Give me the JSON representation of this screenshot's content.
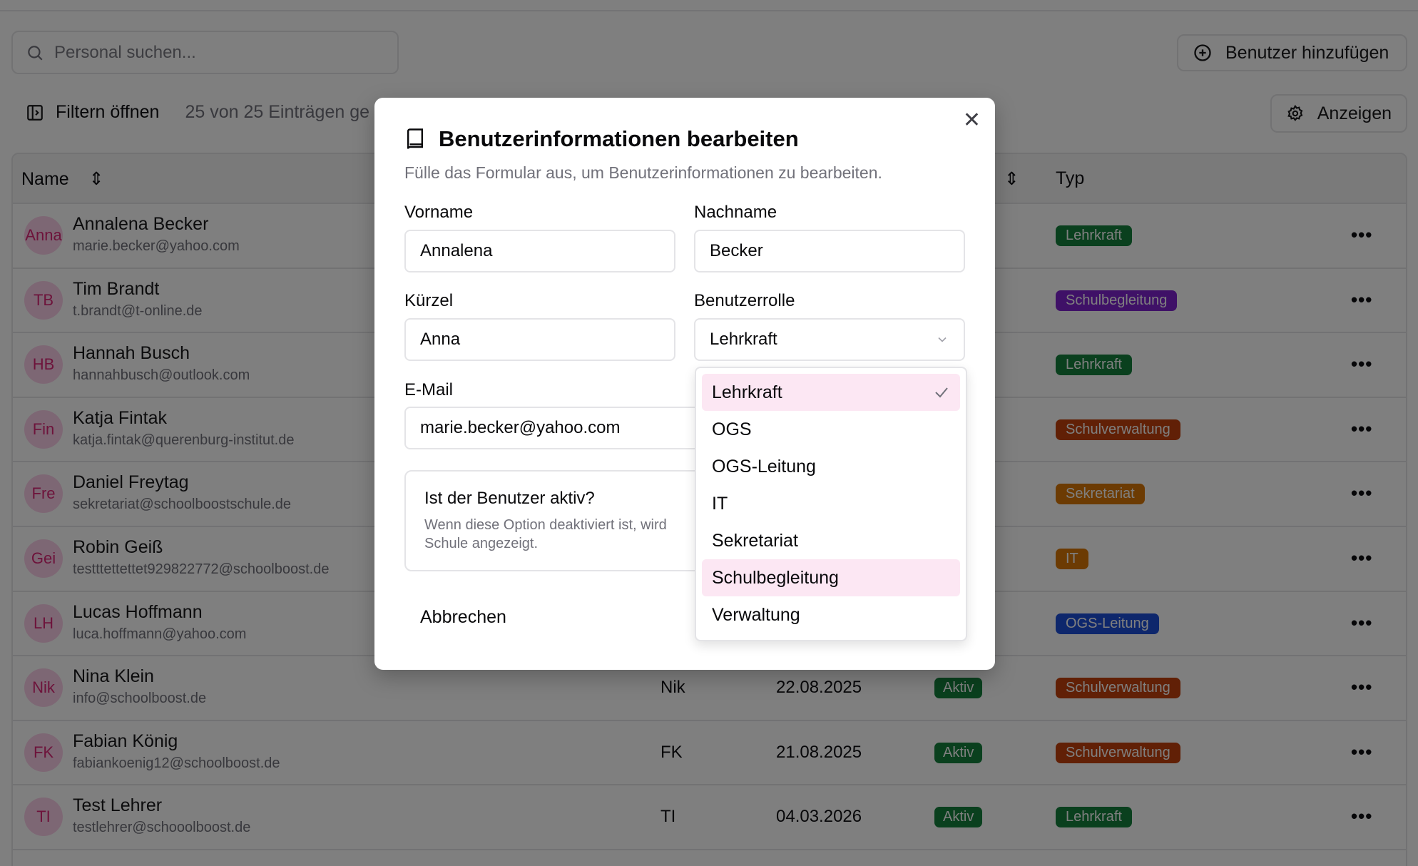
{
  "search": {
    "placeholder": "Personal suchen..."
  },
  "toolbar": {
    "add_user": "Benutzer hinzufügen",
    "filter": "Filtern öffnen",
    "count": "25 von 25 Einträgen ge",
    "show": "Anzeigen"
  },
  "table": {
    "col_name": "Name",
    "col_type": "Typ",
    "rows": [
      {
        "initials": "Anna",
        "name": "Annalena Becker",
        "email": "marie.becker@yahoo.com",
        "kurz": "",
        "date": "",
        "status": "",
        "type": "Lehrkraft",
        "type_color": "#15803d"
      },
      {
        "initials": "TB",
        "name": "Tim Brandt",
        "email": "t.brandt@t-online.de",
        "kurz": "",
        "date": "",
        "status": "",
        "type": "Schulbegleitung",
        "type_color": "#7e22ce"
      },
      {
        "initials": "HB",
        "name": "Hannah Busch",
        "email": "hannahbusch@outlook.com",
        "kurz": "",
        "date": "",
        "status": "",
        "type": "Lehrkraft",
        "type_color": "#15803d"
      },
      {
        "initials": "Fin",
        "name": "Katja Fintak",
        "email": "katja.fintak@querenburg-institut.de",
        "kurz": "",
        "date": "",
        "status": "",
        "type": "Schulverwaltung",
        "type_color": "#c2410c"
      },
      {
        "initials": "Fre",
        "name": "Daniel Freytag",
        "email": "sekretariat@schoolboostschule.de",
        "kurz": "",
        "date": "",
        "status": "",
        "type": "Sekretariat",
        "type_color": "#d97706"
      },
      {
        "initials": "Gei",
        "name": "Robin Geiß",
        "email": "testttettettet929822772@schoolboost.de",
        "kurz": "",
        "date": "",
        "status": "",
        "type": "IT",
        "type_color": "#d97706"
      },
      {
        "initials": "LH",
        "name": "Lucas Hoffmann",
        "email": "luca.hoffmann@yahoo.com",
        "kurz": "",
        "date": "",
        "status": "",
        "type": "OGS-Leitung",
        "type_color": "#1d4ed8"
      },
      {
        "initials": "Nik",
        "name": "Nina Klein",
        "email": "info@schoolboost.de",
        "kurz": "Nik",
        "date": "22.08.2025",
        "status": "Aktiv",
        "type": "Schulverwaltung",
        "type_color": "#c2410c"
      },
      {
        "initials": "FK",
        "name": "Fabian König",
        "email": "fabiankoenig12@schoolboost.de",
        "kurz": "FK",
        "date": "21.08.2025",
        "status": "Aktiv",
        "type": "Schulverwaltung",
        "type_color": "#c2410c"
      },
      {
        "initials": "TI",
        "name": "Test Lehrer",
        "email": "testlehrer@schooolboost.de",
        "kurz": "TI",
        "date": "04.03.2026",
        "status": "Aktiv",
        "type": "Lehrkraft",
        "type_color": "#15803d"
      }
    ]
  },
  "modal": {
    "title": "Benutzerinformationen bearbeiten",
    "subtitle": "Fülle das Formular aus, um Benutzerinformationen zu bearbeiten.",
    "first_name_label": "Vorname",
    "first_name_value": "Annalena",
    "last_name_label": "Nachname",
    "last_name_value": "Becker",
    "short_label": "Kürzel",
    "short_value": "Anna",
    "role_label": "Benutzerrolle",
    "role_value": "Lehrkraft",
    "email_label": "E-Mail",
    "email_value": "marie.becker@yahoo.com",
    "active_title": "Ist der Benutzer aktiv?",
    "active_desc": "Wenn diese Option deaktiviert ist, wird Schule angezeigt.",
    "cancel": "Abbrechen"
  },
  "dropdown": {
    "options": [
      "Lehrkraft",
      "OGS",
      "OGS-Leitung",
      "IT",
      "Sekretariat",
      "Schulbegleitung",
      "Verwaltung"
    ],
    "selected": "Lehrkraft",
    "hovered": "Schulbegleitung"
  }
}
